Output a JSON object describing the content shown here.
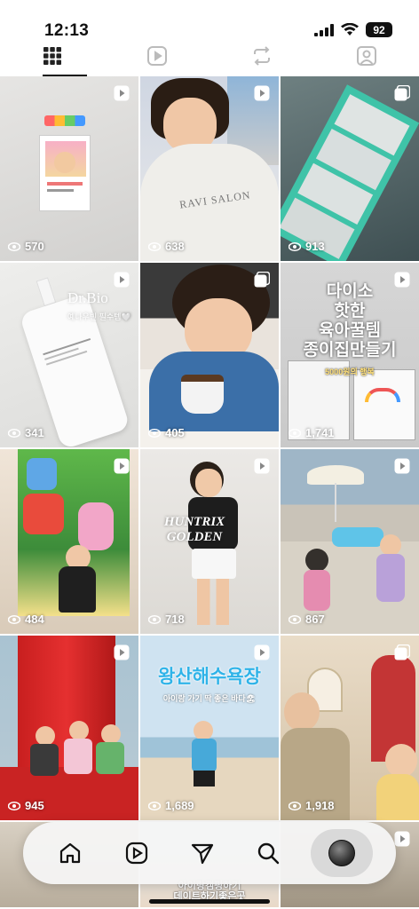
{
  "status_bar": {
    "time": "12:13",
    "battery": "92"
  },
  "tabs": [
    {
      "name": "grid-tab",
      "icon": "grid-icon",
      "active": true
    },
    {
      "name": "reels-tab",
      "icon": "reels-icon",
      "active": false
    },
    {
      "name": "reposts-tab",
      "icon": "repost-icon",
      "active": false
    },
    {
      "name": "tagged-tab",
      "icon": "tagged-person-icon",
      "active": false
    }
  ],
  "posts": [
    {
      "views": "570",
      "type": "reel"
    },
    {
      "views": "638",
      "type": "reel",
      "caption": "RAVI SALON"
    },
    {
      "views": "913",
      "type": "carousel"
    },
    {
      "views": "341",
      "type": "reel",
      "caption": "Dr.Bio",
      "subcaption": "예나우빈 필수템🤍"
    },
    {
      "views": "405",
      "type": "carousel"
    },
    {
      "views": "1,741",
      "type": "reel",
      "caption": "다이소\n핫한\n육아꿀템\n종이집만들기",
      "subcaption": "5000원의 행복"
    },
    {
      "views": "484",
      "type": "reel"
    },
    {
      "views": "718",
      "type": "reel",
      "caption": "HUNTRIX\nGOLDEN"
    },
    {
      "views": "867",
      "type": "reel"
    },
    {
      "views": "945",
      "type": "reel"
    },
    {
      "views": "1,689",
      "type": "reel",
      "caption": "왕산해수욕장",
      "subcaption": "아이랑 가기 딱 좋은 바다🏖"
    },
    {
      "views": "1,918",
      "type": "carousel"
    }
  ],
  "partial_row_text": "아이랑캠핑하기\n데이트하기좋은곳",
  "bottom_nav": [
    {
      "name": "home",
      "icon": "home-icon"
    },
    {
      "name": "reels",
      "icon": "reels-icon"
    },
    {
      "name": "messages",
      "icon": "send-icon"
    },
    {
      "name": "search",
      "icon": "search-icon"
    },
    {
      "name": "profile",
      "icon": "avatar",
      "active": true
    }
  ]
}
